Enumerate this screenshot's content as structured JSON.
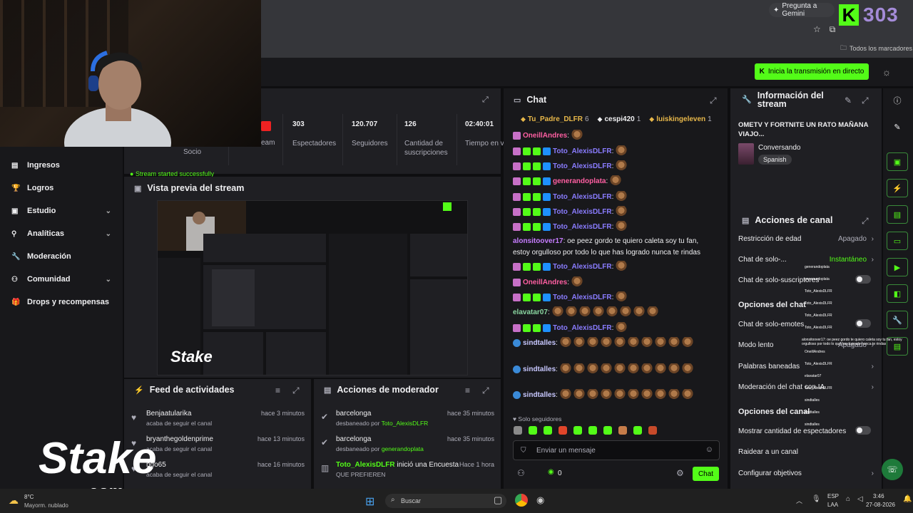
{
  "browser": {
    "gemini_label": "Pregunta a Gemini",
    "bookmarks_label": "Todos los marcadores",
    "kick_badge": "303"
  },
  "header": {
    "start_button": "Inicia la transmisión en directo"
  },
  "sidebar": {
    "items": [
      {
        "label": "Ingresos",
        "icon": "income-icon",
        "has_chevron": false
      },
      {
        "label": "Logros",
        "icon": "trophy-icon",
        "has_chevron": false
      },
      {
        "label": "Estudio",
        "icon": "studio-icon",
        "has_chevron": true
      },
      {
        "label": "Analíticas",
        "icon": "analytics-icon",
        "has_chevron": true
      },
      {
        "label": "Moderación",
        "icon": "wrench-icon",
        "has_chevron": false
      },
      {
        "label": "Comunidad",
        "icon": "community-icon",
        "has_chevron": true
      },
      {
        "label": "Drops y recompensas",
        "icon": "gift-icon",
        "has_chevron": false
      }
    ]
  },
  "stats": {
    "socio_label": "Socio",
    "stream_label": "eam",
    "items": [
      {
        "value": "303",
        "label": "Espectadores"
      },
      {
        "value": "120.707",
        "label": "Seguidores"
      },
      {
        "value": "126",
        "label": "Cantidad de suscripciones"
      },
      {
        "value": "02:40:01",
        "label": "Tiempo en vivo"
      }
    ],
    "status_text": "Stream started successfully"
  },
  "preview": {
    "title": "Vista previa del stream"
  },
  "feed": {
    "title": "Feed de actividades",
    "items": [
      {
        "name": "Benjaatularika",
        "sub": "acaba de seguir el canal",
        "time": "hace 3 minutos"
      },
      {
        "name": "bryanthegoldenprime",
        "sub": "acaba de seguir el canal",
        "time": "hace 13 minutos"
      },
      {
        "name": "ndo65",
        "sub": "acaba de seguir el canal",
        "time": "hace 16 minutos"
      }
    ]
  },
  "mod_actions": {
    "title": "Acciones de moderador",
    "items": [
      {
        "name": "barcelonga",
        "sub_prefix": "desbaneado por ",
        "by": "Toto_AlexisDLFR",
        "time": "hace 35 minutos"
      },
      {
        "name": "barcelonga",
        "sub_prefix": "desbaneado por ",
        "by": "generandoplata",
        "time": "hace 35 minutos"
      },
      {
        "name": "Toto_AlexisDLFR",
        "suffix": " inició una Encuesta",
        "sub": "QUE PREFIEREN",
        "time": "Hace 1 hora"
      }
    ]
  },
  "chat": {
    "title": "Chat",
    "top_gifters": [
      {
        "name": "Tu_Padre_DLFR",
        "count": "6",
        "color": "#e8b84a"
      },
      {
        "name": "cespi420",
        "count": "1",
        "color": "#efeff1"
      },
      {
        "name": "luiskingeleven",
        "count": "1",
        "color": "#e8b84a"
      }
    ],
    "messages": [
      {
        "user": "OneillAndres",
        "color": "#ff5fa2",
        "text": ""
      },
      {
        "user": "Toto_AlexisDLFR",
        "color": "#8a7cff",
        "text": ""
      },
      {
        "user": "Toto_AlexisDLFR",
        "color": "#8a7cff",
        "text": ""
      },
      {
        "user": "generandoplata",
        "color": "#ff5fa2",
        "text": ""
      },
      {
        "user": "Toto_AlexisDLFR",
        "color": "#8a7cff",
        "text": ""
      },
      {
        "user": "Toto_AlexisDLFR",
        "color": "#8a7cff",
        "text": ""
      },
      {
        "user": "Toto_AlexisDLFR",
        "color": "#8a7cff",
        "text": ""
      },
      {
        "user": "alonsitoover17",
        "color": "#c77dff",
        "text": "oe peez gordo te quiero caleta soy tu fan, estoy orgulloso por todo lo que has logrado nunca te rindas"
      },
      {
        "user": "Toto_AlexisDLFR",
        "color": "#8a7cff",
        "text": ""
      },
      {
        "user": "OneillAndres",
        "color": "#ff5fa2",
        "text": ""
      },
      {
        "user": "Toto_AlexisDLFR",
        "color": "#8a7cff",
        "text": ""
      },
      {
        "user": "elavatar07",
        "color": "#8ad6a0",
        "text": ""
      },
      {
        "user": "Toto_AlexisDLFR",
        "color": "#8a7cff",
        "text": ""
      },
      {
        "user": "sindtalles",
        "color": "#c8c8ff",
        "text": ""
      },
      {
        "user": "sindtalles",
        "color": "#c8c8ff",
        "text": ""
      },
      {
        "user": "sindtalles",
        "color": "#c8c8ff",
        "text": ""
      }
    ],
    "followers_only": "Solo seguidores",
    "input_placeholder": "Enviar un mensaje",
    "points": "0",
    "send_button": "Chat"
  },
  "info": {
    "title": "Información del stream",
    "stream_title": "OMETV Y FORTNITE UN RATO MAÑANA VIAJO...",
    "category": "Conversando",
    "language": "Spanish"
  },
  "channel_actions": {
    "title": "Acciones de canal",
    "rows": [
      {
        "label": "Restricción de edad",
        "value": "Apagado",
        "type": "arrow"
      },
      {
        "label": "Chat de solo-...",
        "value": "Instantáneo",
        "type": "arrow",
        "value_color": "#53fc18"
      },
      {
        "label": "Chat de solo-suscriptores",
        "value": "",
        "type": "toggle"
      },
      {
        "label": "Opciones del chat",
        "value": "",
        "type": "header"
      },
      {
        "label": "Chat de solo-emotes",
        "value": "",
        "type": "toggle"
      },
      {
        "label": "Modo lento",
        "value": "Apagado",
        "type": "arrow"
      },
      {
        "label": "Palabras baneadas",
        "value": "",
        "type": "arrow"
      },
      {
        "label": "Moderación del chat con IA",
        "value": "",
        "type": "arrow"
      },
      {
        "label": "Opciones del canal",
        "value": "",
        "type": "header"
      },
      {
        "label": "Mostrar cantidad de espectadores",
        "value": "",
        "type": "toggle"
      },
      {
        "label": "Raidear a un canal",
        "value": "",
        "type": "none"
      },
      {
        "label": "Configurar objetivos",
        "value": "",
        "type": "arrow"
      }
    ]
  },
  "overlay_chat": {
    "lines": [
      "generandoplata",
      "generandoplata",
      "Toto_AlexisDLFR",
      "Toto_AlexisDLFR",
      "Toto_AlexisDLFR",
      "Toto_AlexisDLFR",
      "alonsitoover17: oe peez gordo te quiero caleta soy tu fan, estoy orgulloso por todo lo que has logrado nunca te rindas",
      "OneillAndres",
      "Toto_AlexisDLFR",
      "elavatar07",
      "Toto_AlexisDLFR",
      "sindtalles",
      "sindtalles",
      "sindtalles"
    ]
  },
  "stake_logo": {
    "text": "Stake",
    "sub": ".com"
  },
  "taskbar": {
    "weather_temp": "8°C",
    "weather_desc": "Mayorm. nublado",
    "search_placeholder": "Buscar",
    "lang_1": "ESP",
    "lang_2": "LAA",
    "time": "3:46",
    "date": "27-08-2026"
  },
  "colors": {
    "accent": "#53fc18",
    "panel": "#1f1f23",
    "background": "#0e0e10"
  }
}
